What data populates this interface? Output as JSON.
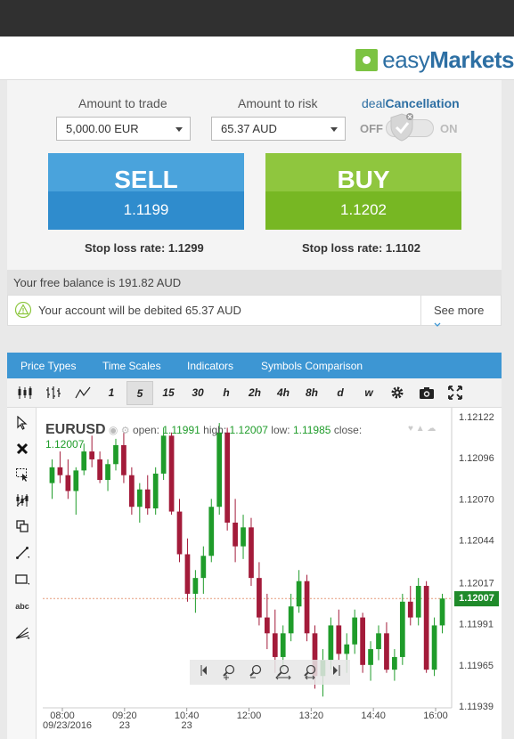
{
  "brand": {
    "name_light": "easy",
    "name_bold": "Markets"
  },
  "trade": {
    "amount_label": "Amount to trade",
    "amount_value": "5,000.00 EUR",
    "risk_label": "Amount to risk",
    "risk_value": "65.37 AUD",
    "deal_cancellation_prefix": "deal",
    "deal_cancellation_bold": "Cancellation",
    "toggle_off": "OFF",
    "toggle_on": "ON",
    "sell_label": "SELL",
    "sell_rate": "1.1199",
    "buy_label": "BUY",
    "buy_rate": "1.1202",
    "sell_stop_loss": "Stop loss rate: 1.1299",
    "buy_stop_loss": "Stop loss rate: 1.1102",
    "free_balance": "Your free balance is 191.82 AUD",
    "debit_notice": "Your account will be debited 65.37 AUD",
    "see_more": "See more"
  },
  "chart_menu": [
    "Price Types",
    "Time Scales",
    "Indicators",
    "Symbols Comparison"
  ],
  "timeframes": [
    "1",
    "5",
    "15",
    "30",
    "h",
    "2h",
    "4h",
    "8h",
    "d",
    "w"
  ],
  "active_timeframe": "5",
  "side_tools": [
    "cursor-icon",
    "delete-icon",
    "select-icon",
    "pattern-icon",
    "clone-icon",
    "trendline-icon",
    "rectangle-icon",
    "text-icon",
    "fan-icon"
  ],
  "text_tool_label": "abc",
  "legend": {
    "symbol": "EURUSD",
    "open_label": "open:",
    "open": "1.11991",
    "high_label": "high:",
    "high": "1.12007",
    "low_label": "low:",
    "low": "1.11985",
    "close_label": "close:",
    "close": "1.12007"
  },
  "chart_data": {
    "type": "candlestick",
    "symbol": "EURUSD",
    "y_ticks": [
      "1.12122",
      "1.12096",
      "1.12070",
      "1.12044",
      "1.12017",
      "1.11991",
      "1.11965",
      "1.11939"
    ],
    "ylim": [
      1.11939,
      1.12122
    ],
    "last_price": "1.12007",
    "x_ticks": [
      {
        "time": "08:00",
        "date": "09/23/2016"
      },
      {
        "time": "09:20",
        "date": "23"
      },
      {
        "time": "10:40",
        "date": "23"
      },
      {
        "time": "12:00",
        "date": ""
      },
      {
        "time": "13:20",
        "date": ""
      },
      {
        "time": "14:40",
        "date": ""
      },
      {
        "time": "16:00",
        "date": ""
      }
    ],
    "candles": [
      [
        1.1208,
        1.12095,
        1.1207,
        1.1209
      ],
      [
        1.1209,
        1.121,
        1.1208,
        1.12085
      ],
      [
        1.12085,
        1.12095,
        1.1207,
        1.12075
      ],
      [
        1.12075,
        1.1209,
        1.1206,
        1.12088
      ],
      [
        1.12088,
        1.12105,
        1.12085,
        1.121
      ],
      [
        1.121,
        1.1211,
        1.1209,
        1.12095
      ],
      [
        1.12095,
        1.121,
        1.1208,
        1.12082
      ],
      [
        1.12082,
        1.12095,
        1.12075,
        1.12092
      ],
      [
        1.12092,
        1.12108,
        1.12088,
        1.12104
      ],
      [
        1.12104,
        1.12112,
        1.1208,
        1.12085
      ],
      [
        1.12085,
        1.1209,
        1.1206,
        1.12065
      ],
      [
        1.12065,
        1.1208,
        1.12055,
        1.12076
      ],
      [
        1.12076,
        1.12085,
        1.1206,
        1.12064
      ],
      [
        1.12064,
        1.1209,
        1.1206,
        1.12086
      ],
      [
        1.12086,
        1.12115,
        1.12082,
        1.1211
      ],
      [
        1.1211,
        1.12112,
        1.1206,
        1.12062
      ],
      [
        1.12062,
        1.1207,
        1.1203,
        1.12035
      ],
      [
        1.12035,
        1.12045,
        1.12005,
        1.1201
      ],
      [
        1.1201,
        1.12025,
        1.11998,
        1.1202
      ],
      [
        1.1202,
        1.1204,
        1.1201,
        1.12034
      ],
      [
        1.12034,
        1.1207,
        1.1203,
        1.12065
      ],
      [
        1.12065,
        1.12118,
        1.1206,
        1.12112
      ],
      [
        1.12112,
        1.12115,
        1.1205,
        1.12055
      ],
      [
        1.12055,
        1.1207,
        1.1203,
        1.1204
      ],
      [
        1.1204,
        1.1206,
        1.12032,
        1.12052
      ],
      [
        1.12052,
        1.12058,
        1.12015,
        1.1202
      ],
      [
        1.1202,
        1.1203,
        1.1199,
        1.11995
      ],
      [
        1.11995,
        1.1201,
        1.11975,
        1.11985
      ],
      [
        1.11985,
        1.12,
        1.1196,
        1.1197
      ],
      [
        1.1197,
        1.1199,
        1.11962,
        1.11985
      ],
      [
        1.11985,
        1.1201,
        1.1198,
        1.12002
      ],
      [
        1.12002,
        1.12025,
        1.11998,
        1.12018
      ],
      [
        1.12018,
        1.12022,
        1.1198,
        1.11985
      ],
      [
        1.11985,
        1.1199,
        1.1195,
        1.11958
      ],
      [
        1.11958,
        1.11975,
        1.11945,
        1.11968
      ],
      [
        1.11968,
        1.11995,
        1.11962,
        1.1199
      ],
      [
        1.1199,
        1.12,
        1.11968,
        1.11972
      ],
      [
        1.11972,
        1.11985,
        1.1196,
        1.11978
      ],
      [
        1.11978,
        1.12,
        1.11972,
        1.11995
      ],
      [
        1.11995,
        1.11998,
        1.1196,
        1.11965
      ],
      [
        1.11965,
        1.1198,
        1.11955,
        1.11975
      ],
      [
        1.11975,
        1.1199,
        1.11968,
        1.11985
      ],
      [
        1.11985,
        1.11992,
        1.1196,
        1.11962
      ],
      [
        1.11962,
        1.11975,
        1.11955,
        1.1197
      ],
      [
        1.1197,
        1.1201,
        1.11965,
        1.12005
      ],
      [
        1.12005,
        1.12015,
        1.1199,
        1.11995
      ],
      [
        1.11995,
        1.1202,
        1.1199,
        1.12015
      ],
      [
        1.12015,
        1.12018,
        1.1196,
        1.11962
      ],
      [
        1.11962,
        1.11995,
        1.11958,
        1.1199
      ],
      [
        1.1199,
        1.1201,
        1.11985,
        1.12007
      ]
    ]
  },
  "colors": {
    "up": "#1f9c2a",
    "down": "#a31b3a",
    "menu": "#3d96d3",
    "sell": "#3a98d6",
    "buy": "#84c030"
  }
}
